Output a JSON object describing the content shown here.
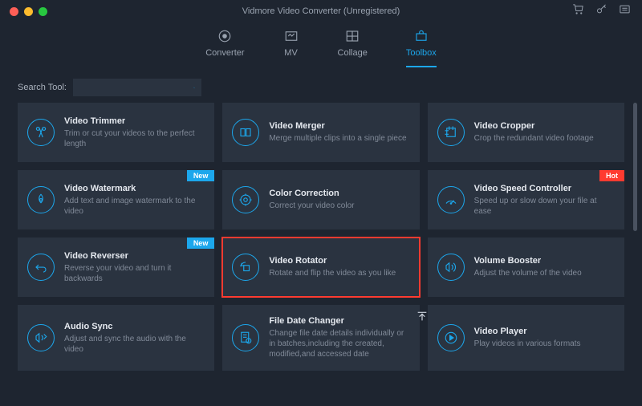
{
  "title": "Vidmore Video Converter (Unregistered)",
  "tabs": [
    {
      "label": "Converter"
    },
    {
      "label": "MV"
    },
    {
      "label": "Collage"
    },
    {
      "label": "Toolbox"
    }
  ],
  "search_label": "Search Tool:",
  "search_placeholder": "",
  "badges": {
    "new": "New",
    "hot": "Hot"
  },
  "tools": [
    {
      "title": "Video Trimmer",
      "desc": "Trim or cut your videos to the perfect length"
    },
    {
      "title": "Video Merger",
      "desc": "Merge multiple clips into a single piece"
    },
    {
      "title": "Video Cropper",
      "desc": "Crop the redundant video footage"
    },
    {
      "title": "Video Watermark",
      "desc": "Add text and image watermark to the video",
      "badge": "new"
    },
    {
      "title": "Color Correction",
      "desc": "Correct your video color"
    },
    {
      "title": "Video Speed Controller",
      "desc": "Speed up or slow down your file at ease",
      "badge": "hot"
    },
    {
      "title": "Video Reverser",
      "desc": "Reverse your video and turn it backwards",
      "badge": "new"
    },
    {
      "title": "Video Rotator",
      "desc": "Rotate and flip the video as you like",
      "highlighted": true
    },
    {
      "title": "Volume Booster",
      "desc": "Adjust the volume of the video"
    },
    {
      "title": "Audio Sync",
      "desc": "Adjust and sync the audio with the video"
    },
    {
      "title": "File Date Changer",
      "desc": "Change file date details individually or in batches,including the created, modified,and accessed date"
    },
    {
      "title": "Video Player",
      "desc": "Play videos in various formats"
    }
  ]
}
